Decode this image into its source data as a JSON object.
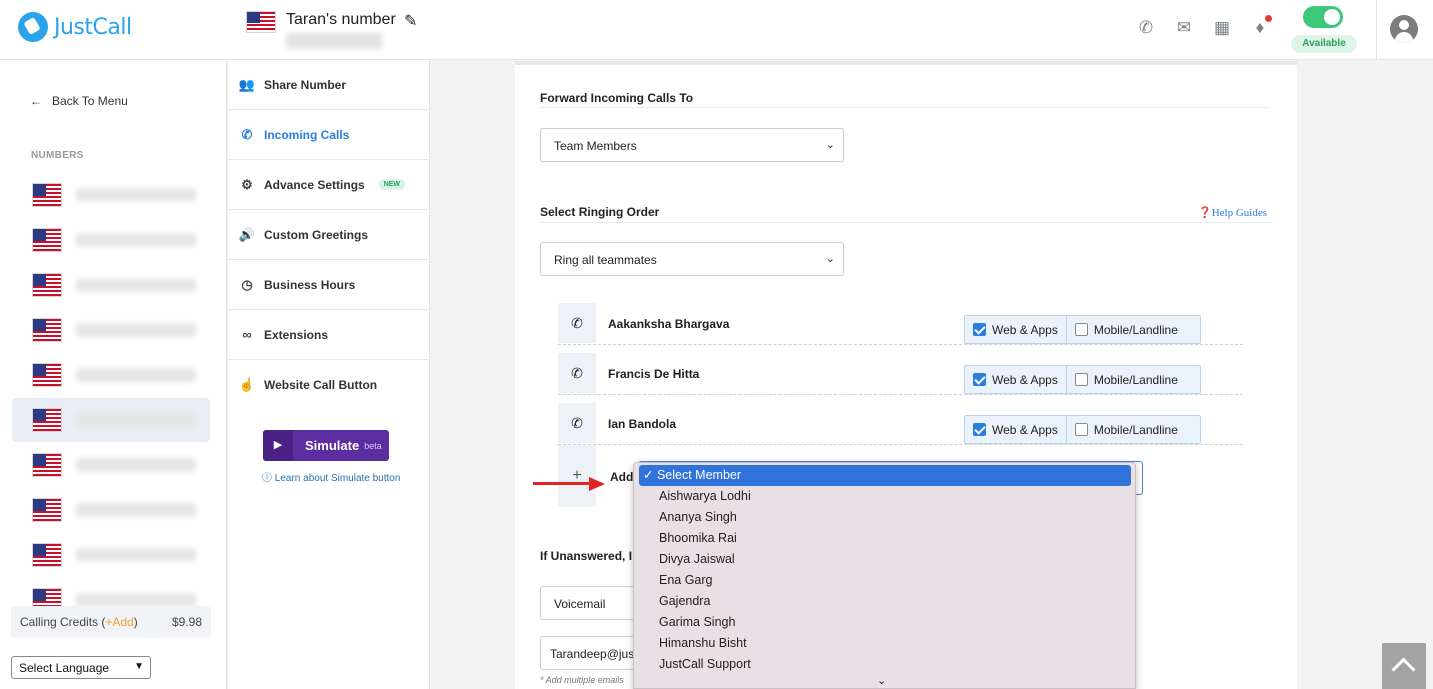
{
  "header": {
    "brand": "JustCall",
    "number_title": "Taran's number",
    "status_label": "Available",
    "icons": [
      "phone-icon",
      "chat-icon",
      "apps-icon",
      "bell-icon",
      "user-avatar-icon"
    ]
  },
  "sidebar": {
    "back_label": "Back To Menu",
    "numbers_label": "NUMBERS",
    "numbers_count": 10,
    "credits_label": "Calling Credits (",
    "credits_add": "+Add",
    "credits_close": ")",
    "credits_amount": "$9.98",
    "language": "Select Language"
  },
  "menu": {
    "items": [
      {
        "label": "Share Number",
        "icon": "users-icon"
      },
      {
        "label": "Incoming Calls",
        "icon": "phone-icon",
        "active": true
      },
      {
        "label": "Advance Settings",
        "icon": "gear-icon",
        "badge": "NEW"
      },
      {
        "label": "Custom Greetings",
        "icon": "speaker-icon"
      },
      {
        "label": "Business Hours",
        "icon": "clock-icon"
      },
      {
        "label": "Extensions",
        "icon": "link-icon"
      },
      {
        "label": "Website Call Button",
        "icon": "pointer-icon"
      }
    ],
    "simulate_label": "Simulate",
    "simulate_badge": "beta",
    "simulate_link": "Learn about Simulate button"
  },
  "main": {
    "forward_title": "Forward Incoming Calls To",
    "forward_value": "Team Members",
    "ringing_title": "Select Ringing Order",
    "help_label": "Help Guides",
    "ringing_value": "Ring all teammates",
    "members": [
      {
        "name": "Aakanksha Bhargava",
        "web": true,
        "mobile": false
      },
      {
        "name": "Francis De Hitta",
        "web": true,
        "mobile": false
      },
      {
        "name": "Ian Bandola",
        "web": true,
        "mobile": false
      }
    ],
    "web_label": "Web & Apps",
    "mobile_label": "Mobile/Landline",
    "add_label": "Add",
    "unanswered_title": "If Unanswered, I",
    "unanswered_value": "Voicemail",
    "email_value": "Tarandeep@jus",
    "email_hint": "* Add multiple emails"
  },
  "dropdown": {
    "options": [
      "Select Member",
      "Aishwarya Lodhi",
      "Ananya Singh",
      "Bhoomika Rai",
      "Divya Jaiswal",
      "Ena Garg",
      "Gajendra",
      "Garima Singh",
      "Himanshu Bisht",
      "JustCall Support"
    ],
    "selected": "Select Member"
  },
  "colors": {
    "accent": "#2a7de1",
    "simulate": "#5b2d9e",
    "available": "#3ec97a",
    "arrow": "#e32222"
  }
}
